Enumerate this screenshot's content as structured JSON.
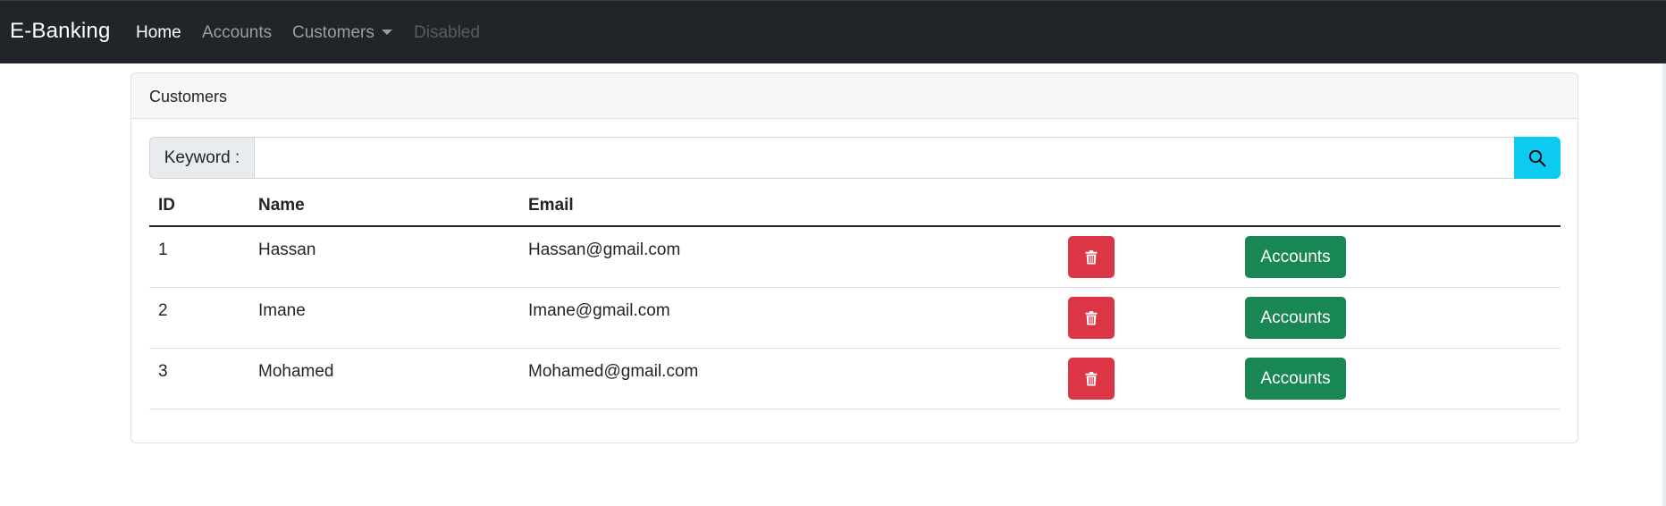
{
  "navbar": {
    "brand": "E-Banking",
    "links": [
      {
        "label": "Home",
        "state": "active"
      },
      {
        "label": "Accounts",
        "state": "normal"
      },
      {
        "label": "Customers",
        "state": "dropdown"
      },
      {
        "label": "Disabled",
        "state": "disabled"
      }
    ],
    "background": "#212529"
  },
  "card": {
    "header": "Customers",
    "search": {
      "label": "Keyword :",
      "value": "",
      "placeholder": "",
      "button_icon": "search-icon",
      "button_color": "#0dcaf0"
    },
    "table": {
      "columns": [
        "ID",
        "Name",
        "Email"
      ],
      "rows": [
        {
          "id": "1",
          "name": "Hassan",
          "email": "Hassan@gmail.com",
          "action": "Accounts"
        },
        {
          "id": "2",
          "name": "Imane",
          "email": "Imane@gmail.com",
          "action": "Accounts"
        },
        {
          "id": "3",
          "name": "Mohamed",
          "email": "Mohamed@gmail.com",
          "action": "Accounts"
        }
      ],
      "delete_icon": "trash-icon",
      "delete_color": "#dc3545",
      "accounts_color": "#198754"
    }
  }
}
